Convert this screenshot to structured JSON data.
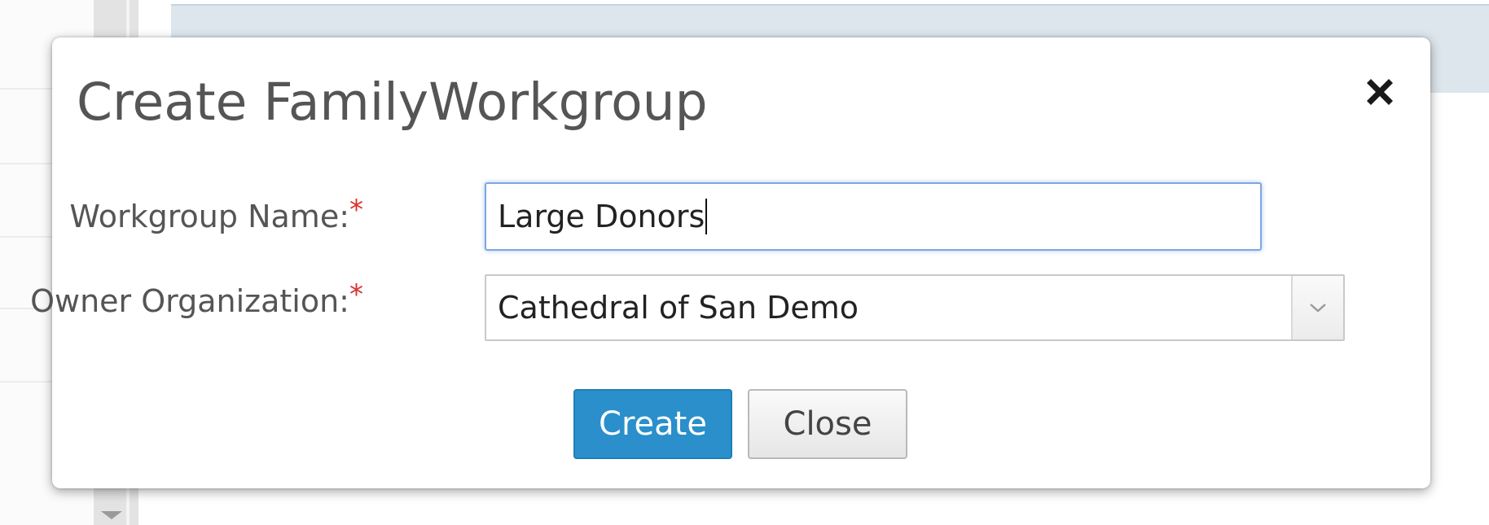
{
  "dialog": {
    "title": "Create FamilyWorkgroup",
    "close_icon": "close-icon",
    "fields": {
      "workgroup_name": {
        "label": "Workgroup Name:",
        "required_marker": "*",
        "value": "Large Donors"
      },
      "owner_organization": {
        "label": "Owner Organization:",
        "required_marker": "*",
        "selected": "Cathedral of San Demo"
      }
    },
    "buttons": {
      "create_label": "Create",
      "close_label": "Close"
    }
  },
  "colors": {
    "primary_button": "#2a8fcb",
    "required_marker": "#d9302c",
    "focus_border": "#7ea8e2"
  }
}
